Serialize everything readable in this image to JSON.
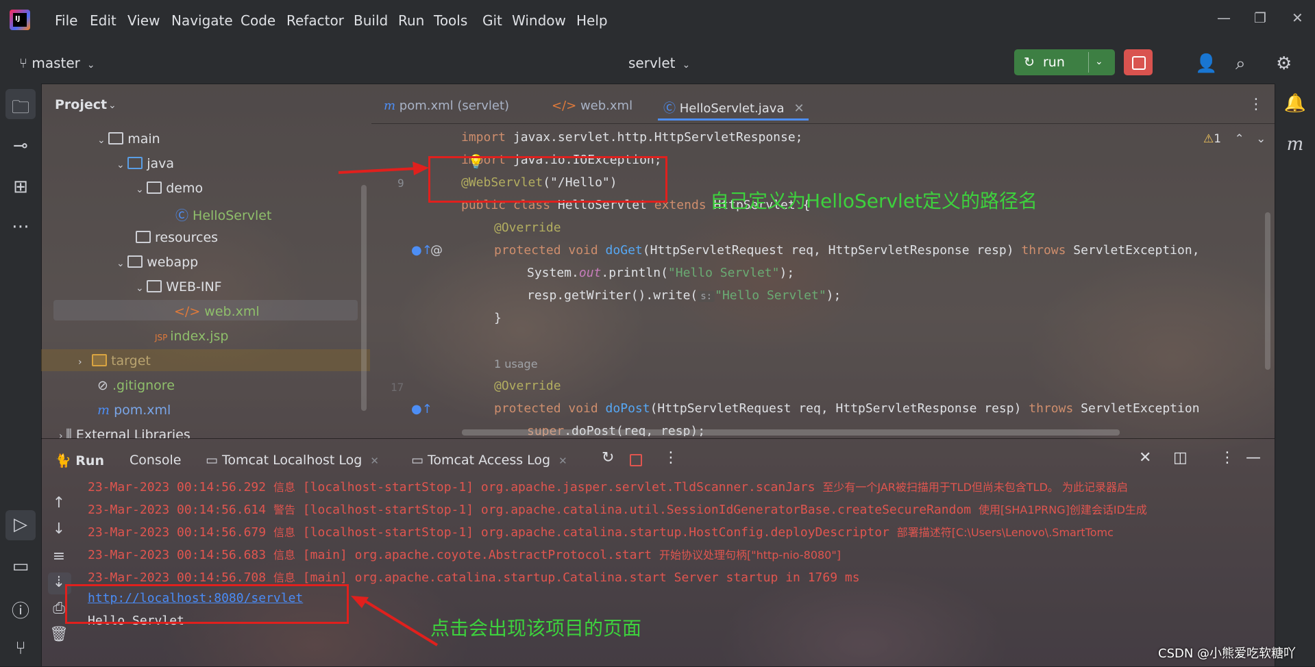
{
  "window": {
    "menu": [
      "File",
      "Edit",
      "View",
      "Navigate",
      "Code",
      "Refactor",
      "Build",
      "Run",
      "Tools",
      "Git",
      "Window",
      "Help"
    ],
    "controls": {
      "minimize": "—",
      "restore": "❐",
      "close": "✕"
    }
  },
  "toolbar": {
    "branch": "master",
    "project": "servlet",
    "run_label": "run",
    "icons": [
      "add-user-icon",
      "search-icon",
      "gear-icon"
    ]
  },
  "project_panel": {
    "title": "Project",
    "items": [
      {
        "label": "main"
      },
      {
        "label": "java"
      },
      {
        "label": "demo"
      },
      {
        "label": "HelloServlet"
      },
      {
        "label": "resources"
      },
      {
        "label": "webapp"
      },
      {
        "label": "WEB-INF"
      },
      {
        "label": "web.xml"
      },
      {
        "label": "index.jsp"
      },
      {
        "label": "target"
      },
      {
        "label": ".gitignore"
      },
      {
        "label": "pom.xml"
      },
      {
        "label": "External Libraries"
      }
    ]
  },
  "editor": {
    "tabs": [
      {
        "label": "pom.xml (servlet)",
        "icon": "maven-icon"
      },
      {
        "label": "web.xml",
        "icon": "xml-icon"
      },
      {
        "label": "HelloServlet.java",
        "icon": "class-icon",
        "active": true
      }
    ],
    "warnings": "1",
    "line_numbers": [
      "9",
      "17"
    ],
    "usage_hint": "1 usage",
    "param_hint": "s:",
    "code": {
      "l1_kw": "import",
      "l1_rest": " javax.servlet.http.HttpServletResponse;",
      "l2_kw": "import",
      "l2_rest": " java.io.IOException;",
      "l3_ann": "@WebServlet",
      "l3_rest": "(\"/Hello\")",
      "l4_kw": "public class",
      "l4_name": " HelloServlet ",
      "l4_ext": "extends",
      "l4_rest": " HttpServlet {",
      "l5": "@Override",
      "l6_kw": "protected void",
      "l6_fn": " doGet",
      "l6_params": "(HttpServletRequest req, HttpServletResponse resp) ",
      "l6_throws": "throws",
      "l6_exc": " ServletException,",
      "l7_a": "System.",
      "l7_out": "out",
      "l7_b": ".println(",
      "l7_str": "\"Hello Servlet\"",
      "l7_c": ");",
      "l8_a": "resp.getWriter().write(",
      "l8_str": "\"Hello Servlet\"",
      "l8_c": ");",
      "l9": "}",
      "l10": "@Override",
      "l11_kw": "protected void",
      "l11_fn": " doPost",
      "l11_params": "(HttpServletRequest req, HttpServletResponse resp) ",
      "l11_throws": "throws",
      "l11_exc": " ServletException",
      "l12_kw": "super",
      "l12_rest": ".doPost(req, resp);"
    }
  },
  "run_panel": {
    "tabs": [
      "Run",
      "Console",
      "Tomcat Localhost Log",
      "Tomcat Access Log"
    ],
    "log": [
      {
        "time": "23-Mar-2023 00:14:56.292",
        "level": "信息",
        "text": " [localhost-startStop-1] org.apache.jasper.servlet.TldScanner.scanJars ",
        "cn": "至少有一个JAR被扫描用于TLD但尚未包含TLD。 为此记录器启"
      },
      {
        "time": "23-Mar-2023 00:14:56.614",
        "level": "警告",
        "text": " [localhost-startStop-1] org.apache.catalina.util.SessionIdGeneratorBase.createSecureRandom ",
        "cn": "使用[SHA1PRNG]创建会话ID生成"
      },
      {
        "time": "23-Mar-2023 00:14:56.679",
        "level": "信息",
        "text": " [localhost-startStop-1] org.apache.catalina.startup.HostConfig.deployDescriptor ",
        "cn": "部署描述符[C:\\Users\\Lenovo\\.SmartTomc"
      },
      {
        "time": "23-Mar-2023 00:14:56.683",
        "level": "信息",
        "text": " [main] org.apache.coyote.AbstractProtocol.start ",
        "cn": "开始协议处理句柄[\"http-nio-8080\"]"
      },
      {
        "time": "23-Mar-2023 00:14:56.708",
        "level": "信息",
        "text": " [main] org.apache.catalina.startup.Catalina.start Server startup in 1769 ms",
        "cn": ""
      }
    ],
    "url": "http://localhost:8080/servlet",
    "output": "Hello Servlet"
  },
  "annotations": {
    "note1": "自己定义为HelloServlet定义的路径名",
    "note2": "点击会出现该项目的页面"
  },
  "watermark": "CSDN @小熊爱吃软糖吖",
  "colors": {
    "accent": "#4d8ef5",
    "run_green": "#3d7f43",
    "stop_red": "#d9534f",
    "annotation_green": "#3dd13d",
    "highlight_red": "#e0201d"
  }
}
